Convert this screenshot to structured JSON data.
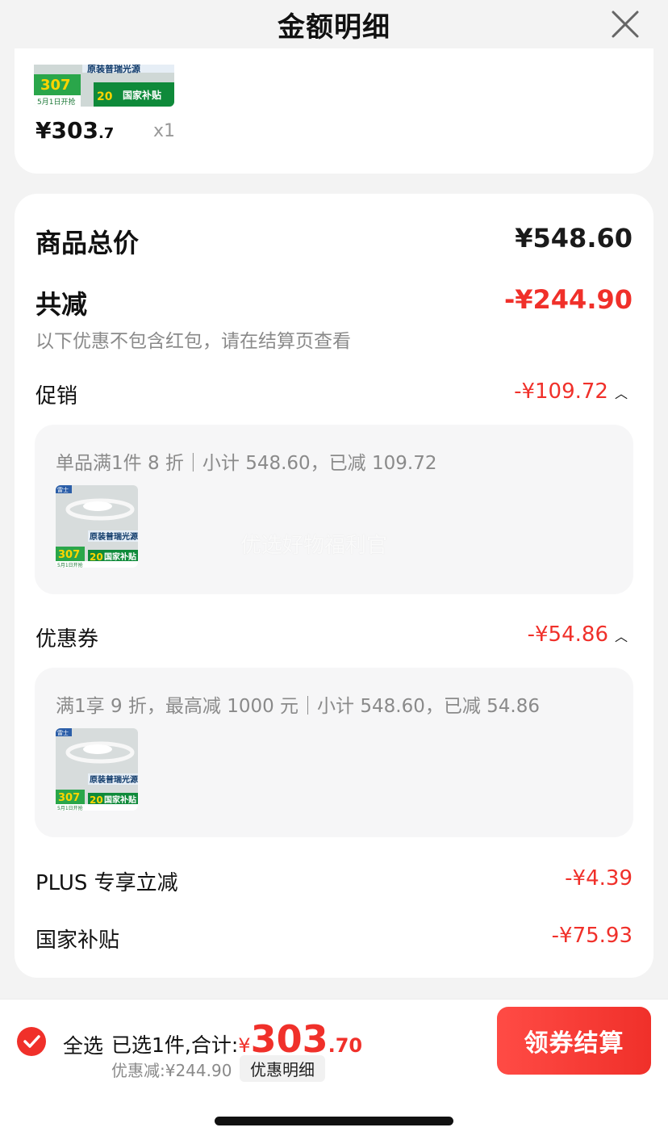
{
  "header": {
    "title": "金额明细",
    "close_icon": "close-icon"
  },
  "product": {
    "price_int": "¥303",
    "price_dec": ".7",
    "quantity": "x1",
    "thumb": {
      "tag": "307",
      "date_badge": "5月1日开抢",
      "top_text": "原装普瑞光源",
      "subsidy": "国家补贴",
      "num": "20",
      "brand": "雷士"
    }
  },
  "summary": {
    "total_label": "商品总价",
    "total_value": "¥548.60",
    "reduce_label": "共减",
    "reduce_value": "-¥244.90",
    "note": "以下优惠不包含红包，请在结算页查看"
  },
  "promotion": {
    "label": "促销",
    "value": "-¥109.72",
    "detail": "单品满1件 8 折｜小计 548.60，已减 109.72"
  },
  "coupon": {
    "label": "优惠券",
    "value": "-¥54.86",
    "detail": "满1享 9 折，最高减 1000 元｜小计 548.60，已减 54.86"
  },
  "plus": {
    "label": "PLUS 专享立减",
    "value": "-¥4.39"
  },
  "subsidy": {
    "label": "国家补贴",
    "value": "-¥75.93"
  },
  "watermark": "优选好物福利官",
  "bottom": {
    "select_all": "全选",
    "selected_text": "已选1件,合计:",
    "currency": "¥",
    "total_int": "303",
    "total_dec": ".70",
    "discount_text": "优惠减:¥244.90",
    "detail_link": "优惠明细",
    "checkout": "领券结算"
  },
  "colors": {
    "accent": "#f0302a",
    "background": "#f3f3f3"
  }
}
